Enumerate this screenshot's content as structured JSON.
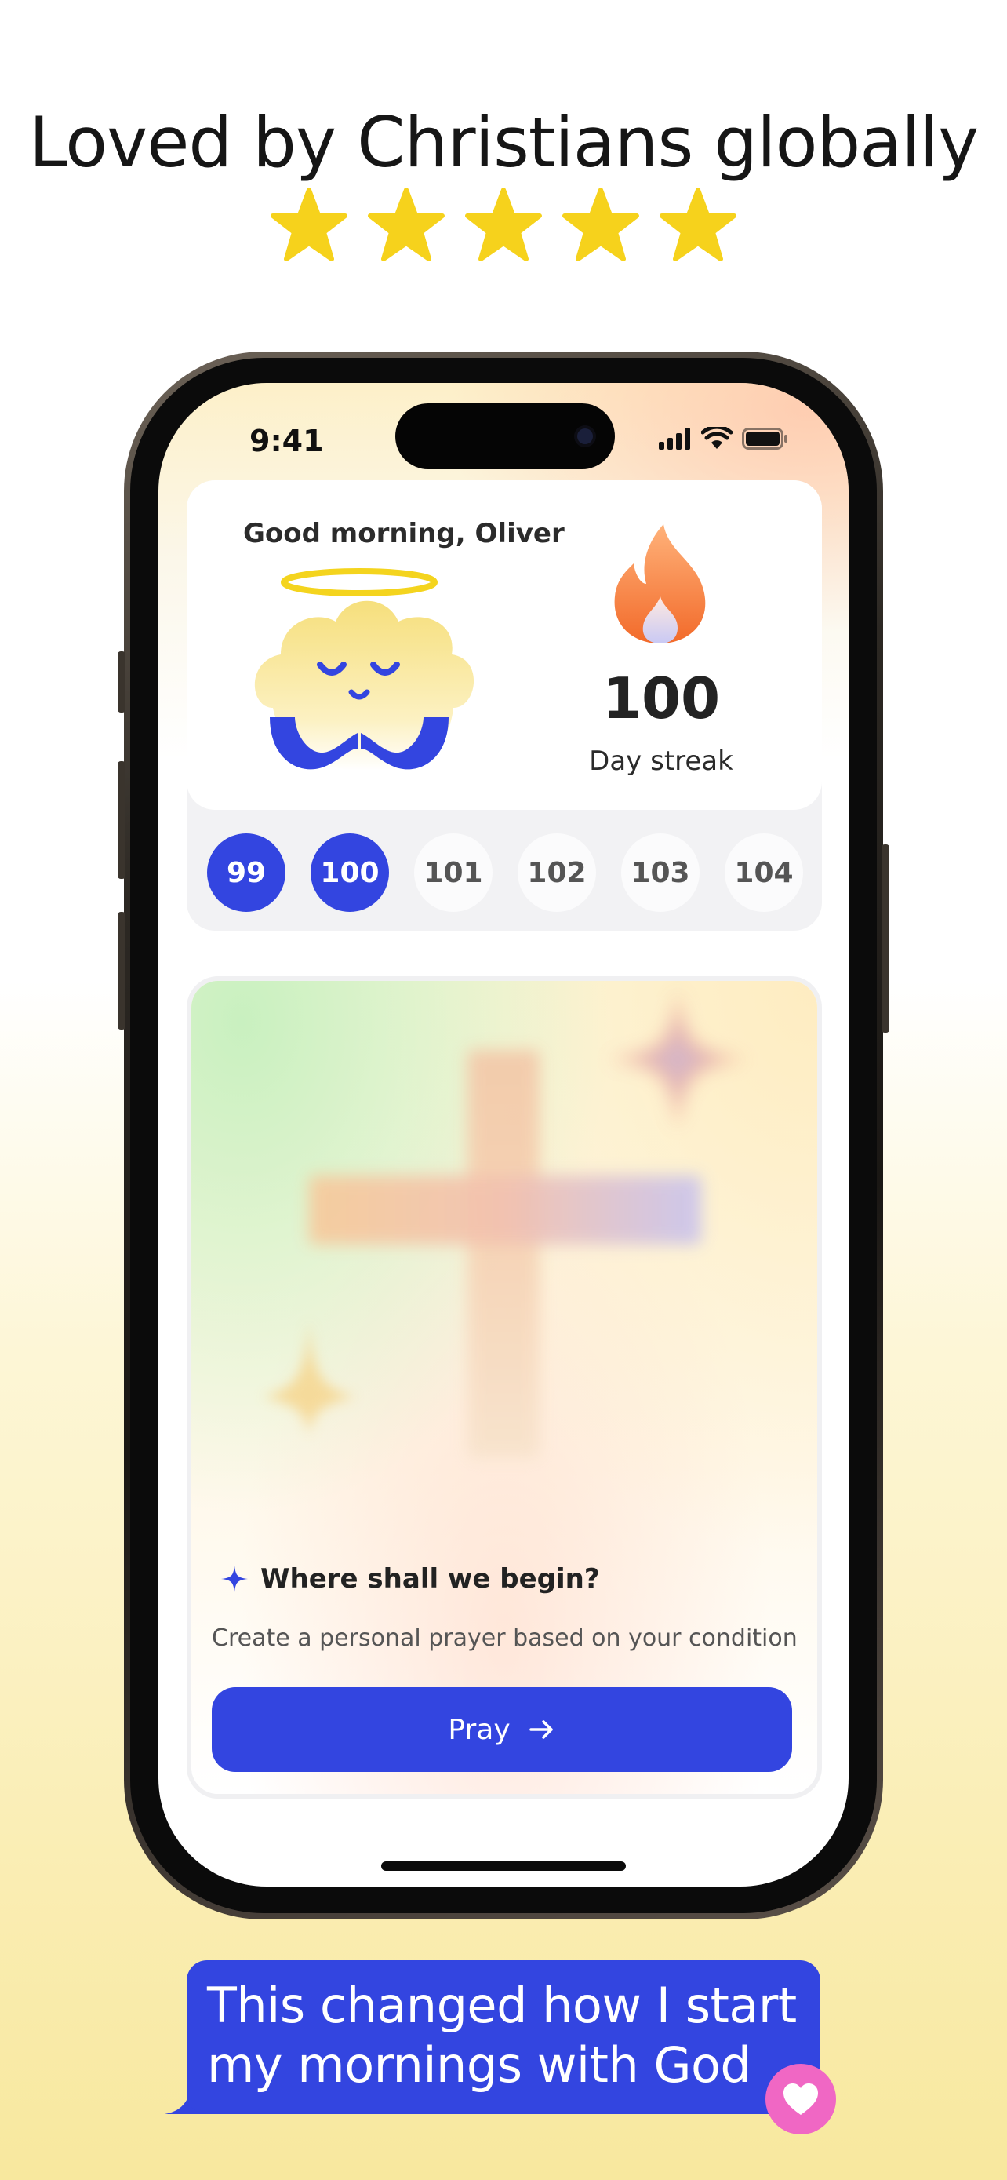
{
  "header": {
    "title": "Loved by Christians globally",
    "rating": 5,
    "star_color": "#f6d21c"
  },
  "status_bar": {
    "time": "9:41",
    "icons": [
      "cellular-signal-icon",
      "wifi-icon",
      "battery-icon"
    ]
  },
  "streak": {
    "greeting": "Good morning, Oliver",
    "count": "100",
    "label": "Day streak",
    "days": [
      {
        "label": "99",
        "active": true
      },
      {
        "label": "100",
        "active": true
      },
      {
        "label": "101",
        "active": false
      },
      {
        "label": "102",
        "active": false
      },
      {
        "label": "103",
        "active": false
      },
      {
        "label": "104",
        "active": false
      }
    ]
  },
  "prayer": {
    "title": "Where shall we begin?",
    "subtitle": "Create a personal prayer based on your condition",
    "button_label": "Pray",
    "button_icon": "arrow-right-icon"
  },
  "testimonial": {
    "line1": "This changed how I start",
    "line2": "my mornings with God",
    "icon": "heart-icon"
  },
  "colors": {
    "accent": "#3345e0",
    "heart": "#f067c4"
  }
}
